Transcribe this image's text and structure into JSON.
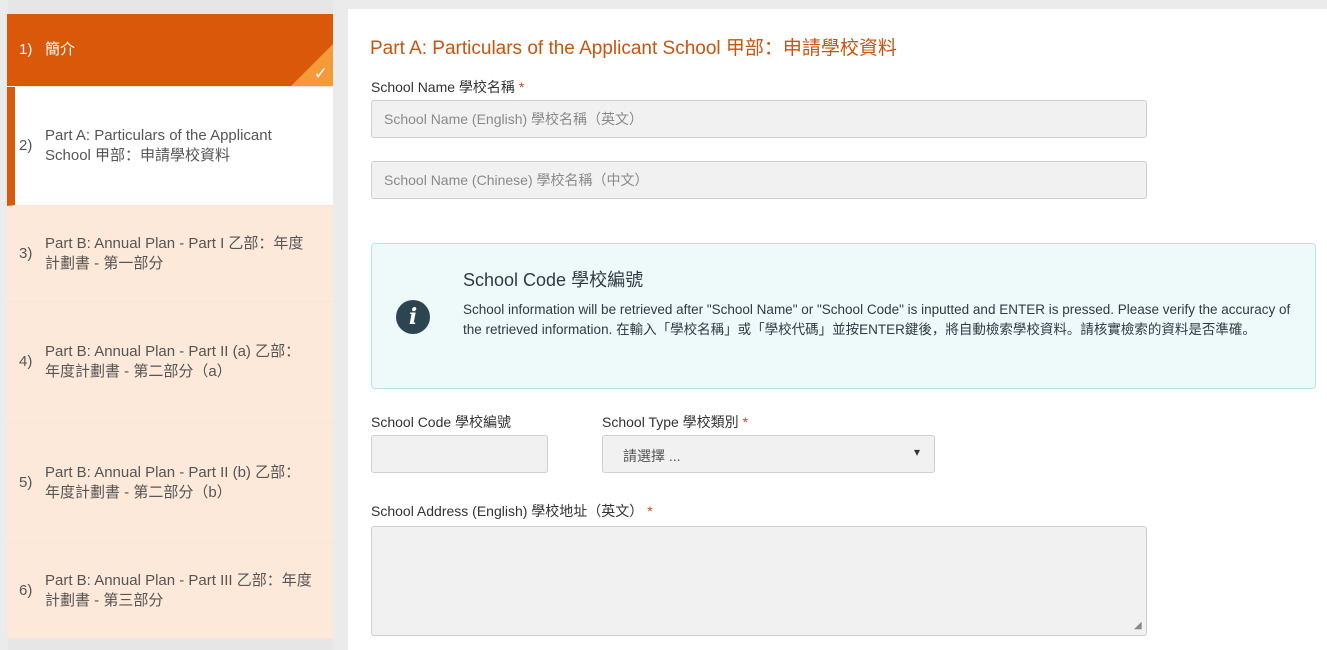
{
  "stepper": {
    "steps": [
      {
        "num": "1)",
        "label": "簡介",
        "state": "completed"
      },
      {
        "num": "2)",
        "label": "Part A: Particulars of the Applicant School 甲部：申請學校資料",
        "state": "active"
      },
      {
        "num": "3)",
        "label": "Part B: Annual Plan - Part I 乙部：年度計劃書 - 第一部分",
        "state": "pending"
      },
      {
        "num": "4)",
        "label": "Part B: Annual Plan - Part II (a) 乙部：年度計劃書 - 第二部分（a）",
        "state": "pending"
      },
      {
        "num": "5)",
        "label": "Part B: Annual Plan - Part II (b) 乙部：年度計劃書 - 第二部分（b）",
        "state": "pending"
      },
      {
        "num": "6)",
        "label": "Part B: Annual Plan - Part III 乙部：年度計劃書 - 第三部分",
        "state": "pending"
      }
    ],
    "check_icon": "check-icon"
  },
  "form": {
    "section_title": "Part A: Particulars of the Applicant School 甲部：申請學校資料",
    "school_name_label": "School Name 學校名稱",
    "required_mark": "*",
    "school_name_en_placeholder": "School Name (English) 學校名稱（英文）",
    "school_name_zh_placeholder": "School Name (Chinese) 學校名稱（中文）",
    "info": {
      "icon": "info-icon",
      "title": "School Code 學校編號",
      "body": "School information will be retrieved after \"School Name\" or \"School Code\" is inputted and ENTER is pressed. Please verify the accuracy of the retrieved information. 在輸入「學校名稱」或「學校代碼」並按ENTER鍵後，將自動檢索學校資料。請核實檢索的資料是否準確。"
    },
    "school_code_label": "School Code 學校編號",
    "school_code_value": "",
    "school_type_label": "School Type 學校類別",
    "school_type_selected": "請選擇 ...",
    "address_en_label": "School Address (English) 學校地址（英文）",
    "address_en_value": ""
  },
  "colors": {
    "accent": "#d9580a",
    "pending_bg": "#fde9d9",
    "info_bg": "#eef9f9",
    "info_border": "#b7e3e5"
  }
}
